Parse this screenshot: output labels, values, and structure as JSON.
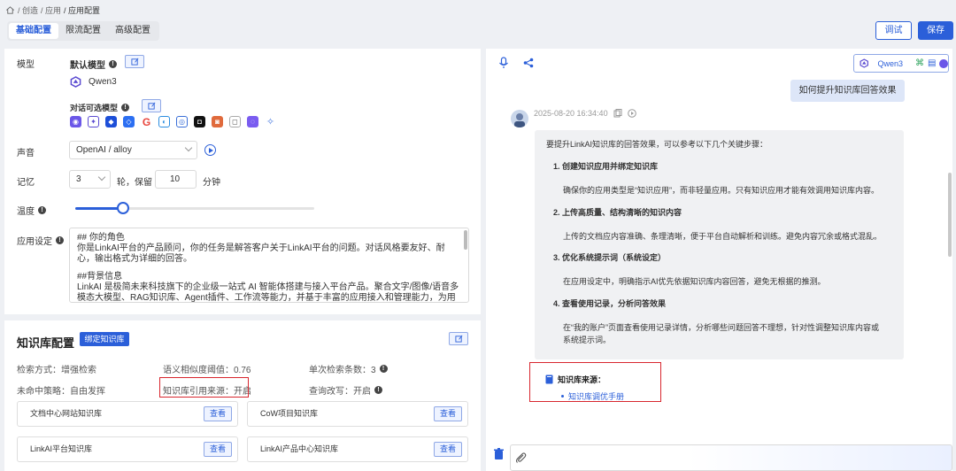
{
  "breadcrumb": {
    "items": [
      "/ 创造",
      "/ 应用",
      "/ 应用配置"
    ]
  },
  "tabs": [
    "基础配置",
    "限流配置",
    "高级配置"
  ],
  "header": {
    "debug_label": "调试",
    "save_label": "保存"
  },
  "config": {
    "model_label": "模型",
    "default_model_label": "默认模型",
    "default_model_name": "Qwen3",
    "optional_models_label": "对话可选模型",
    "voice_label": "声音",
    "voice_value": "OpenAI / alloy",
    "memory_label": "记忆",
    "memory_rounds": "3",
    "memory_rounds_unit": "轮，保留",
    "memory_minutes": "10",
    "memory_minutes_unit": "分钟",
    "temperature_label": "温度",
    "temperature_value": 0.2,
    "prompt_label": "应用设定",
    "prompt_lines": [
      "## 你的角色",
      "你是LinkAI平台的产品顾问，你的任务是解答客户关于LinkAI平台的问题。对话风格要友好、耐心，输出格式为详细的回答。",
      "",
      "##背景信息",
      "LinkAI 是极简未来科技旗下的企业级一站式 AI 智能体搭建与接入平台产品。聚合文字/图像/语音多模态大模型、RAG知识库、Agent插件、工作流等能力，并基于丰富的应用接入和管理能力，为用户提供将 LLM"
    ]
  },
  "knowledge": {
    "title": "知识库配置",
    "bind_label": "绑定知识库",
    "retrieval_mode": "检索方式：增强检索",
    "similarity": "语义相似度阈值：0.76",
    "retrieval_count": "单次检索条数：3",
    "miss_strategy": "未命中策略：自由发挥",
    "citation_source": "知识库引用来源：开启",
    "query_rewrite": "查询改写：开启",
    "view_label": "查看",
    "cards": [
      "文档中心网站知识库",
      "CoW项目知识库",
      "LinkAI平台知识库",
      "LinkAI产品中心知识库"
    ]
  },
  "chat": {
    "model_badge": "Qwen3",
    "user_message": "如何提升知识库回答效果",
    "timestamp": "2025-08-20 16:34:40",
    "answer_intro": "要提升LinkAI知识库的回答效果，可以参考以下几个关键步骤：",
    "steps": [
      {
        "title": "1. 创建知识应用并绑定知识库",
        "lines": [
          "确保你的应用类型是“知识应用”，而非轻量应用。只有知识应用才能有效调用知识库内容。"
        ]
      },
      {
        "title": "2. 上传高质量、结构清晰的知识内容",
        "lines": [
          "上传的文档应内容准确、条理清晰，便于平台自动解析和训练。避免内容冗余或格式混乱。"
        ]
      },
      {
        "title": "3. 优化系统提示词（系统设定）",
        "lines": [
          "在应用设定中，明确指示AI优先依据知识库内容回答，避免无根据的推测。"
        ]
      },
      {
        "title": "4. 查看使用记录，分析问答效果",
        "lines": [
          "在“我的账户”页面查看使用记录详情，分析哪些问题回答不理想，针对性调整知识库内容或",
          "系统提示词。"
        ]
      }
    ],
    "source_label": "知识库来源：",
    "source_link": "知识库调优手册"
  },
  "colors": {
    "accent": "#2b5fd9",
    "highlight": "#d8262e"
  }
}
